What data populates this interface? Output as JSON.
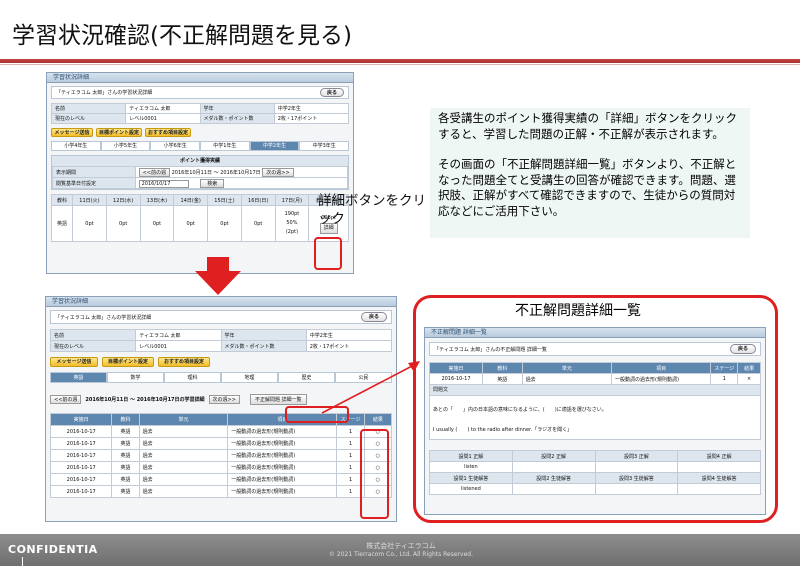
{
  "slide": {
    "title": "学習状況確認(不正解問題を見る)",
    "callout_detail_button": "詳細ボタンをクリック",
    "callout_incorrect_list": "不正解問題詳細一覧",
    "note_p1": "各受講生のポイント獲得実績の「詳細」ボタンをクリックすると、学習した問題の正解・不正解が表示されます。",
    "note_p2": "その画面の「不正解問題詳細一覧」ボタンより、不正解となった問題全てと受講生の回答が確認できます。問題、選択肢、正解がすべて確認できますので、生徒からの質問対応などにご活用下さい。",
    "footer_confidential": "CONFIDENTIA",
    "footer_company": "株式会社ティエラコム",
    "footer_copyright": "© 2021  Tierracom Co., Ltd. All Rights Reserved."
  },
  "screen1": {
    "window_title": "学習状況詳細",
    "header": "「ティエラコム 太郎」さんの学習状況詳細",
    "back": "戻る",
    "info": [
      [
        "名前",
        "ティエラコム 太郎",
        "学年",
        "中学2年生"
      ],
      [
        "現在のレベル",
        "レベル0001",
        "メダル数・ポイント数",
        "2枚・17ポイント"
      ]
    ],
    "buttons": [
      "メッセージ送信",
      "目標ポイント設定",
      "おすすめ項目設定"
    ],
    "tabs": [
      "小学4年生",
      "小学5年生",
      "小学6年生",
      "中学1年生",
      "中学2年生",
      "中学3年生"
    ],
    "active_tab": 4,
    "section_title": "ポイント獲得実績",
    "period_label": "表示期間",
    "prev_week": "<<前の週",
    "period": "2016年10月11日 ～ 2016年10月17日",
    "next_week": "次の週>>",
    "base_date_label": "閲覧基準日付設定",
    "base_date": "2016/10/17",
    "search": "検索",
    "col_subject": "教科",
    "days": [
      "11日(火)",
      "12日(水)",
      "13日(木)",
      "14日(金)",
      "15日(土)",
      "16日(日)",
      "17日(月)",
      "教科別合計"
    ],
    "row_subject": "英語",
    "row_values": [
      "0pt",
      "0pt",
      "0pt",
      "0pt",
      "0pt",
      "0pt"
    ],
    "day17": [
      "190pt",
      "50%",
      "(2pt)"
    ],
    "total": [
      "193pt",
      "詳細"
    ]
  },
  "screen2": {
    "window_title": "学習状況詳細",
    "header": "「ティエラコム 太郎」さんの学習状況詳細",
    "back": "戻る",
    "info": [
      [
        "名前",
        "ティエラコム 太郎",
        "学年",
        "中学2年生"
      ],
      [
        "現在のレベル",
        "レベル0001",
        "メダル数・ポイント数",
        "2枚・17ポイント"
      ]
    ],
    "buttons": [
      "メッセージ送信",
      "目標ポイント設定",
      "おすすめ項目設定"
    ],
    "tabs": [
      "英語",
      "数学",
      "理科",
      "地理",
      "歴史",
      "公民"
    ],
    "active_tab": 0,
    "prev_week": "<<前の週",
    "period": "2016年10月11日 ～ 2016年10月17日の学習詳細",
    "next_week": "次の週>>",
    "incorrect_list_button": "不正解問題 詳細一覧",
    "columns": [
      "実施日",
      "教科",
      "単元",
      "項目",
      "ステージ",
      "結果"
    ],
    "rows": [
      [
        "2016-10-17",
        "英語",
        "過去",
        "一般動詞の過去形(規則動詞)",
        "1",
        "○"
      ],
      [
        "2016-10-17",
        "英語",
        "過去",
        "一般動詞の過去形(規則動詞)",
        "1",
        "○"
      ],
      [
        "2016-10-17",
        "英語",
        "過去",
        "一般動詞の過去形(規則動詞)",
        "1",
        "○"
      ],
      [
        "2016-10-17",
        "英語",
        "過去",
        "一般動詞の過去形(規則動詞)",
        "1",
        "○"
      ],
      [
        "2016-10-17",
        "英語",
        "過去",
        "一般動詞の過去形(規則動詞)",
        "1",
        "○"
      ],
      [
        "2016-10-17",
        "英語",
        "過去",
        "一般動詞の過去形(規則動詞)",
        "1",
        "○"
      ]
    ]
  },
  "screen3": {
    "window_title": "不正解問題 詳細一覧",
    "header": "「ティエラコム 太郎」さんの不正解問題 詳細一覧",
    "back": "戻る",
    "columns": [
      "実施日",
      "教科",
      "単元",
      "項目",
      "ステージ",
      "結果"
    ],
    "row": [
      "2016-10-17",
      "英語",
      "過去",
      "一般動詞の過去形(規則動詞)",
      "1",
      "×"
    ],
    "question_label": "問題文",
    "question_ja": "あとの「　　」内の日本語の意味になるように、(　　)に適語を選びなさい。",
    "question_en": "I usually (　　) to the radio after dinner.「ラジオを聞く」",
    "answer_headers": [
      "設問1 正解",
      "設問2 正解",
      "設問3 正解",
      "設問4 正解"
    ],
    "answer_row": [
      "listen",
      "",
      "",
      ""
    ],
    "student_headers": [
      "設問1 生徒解答",
      "設問2 生徒解答",
      "設問3 生徒解答",
      "設問4 生徒解答"
    ],
    "student_row": [
      "listened",
      "",
      "",
      ""
    ]
  },
  "colors": {
    "title_rule": "#c94141",
    "table_header": "#5e87b0",
    "highlight_red": "#e02020",
    "arrow_red": "#e02020"
  }
}
